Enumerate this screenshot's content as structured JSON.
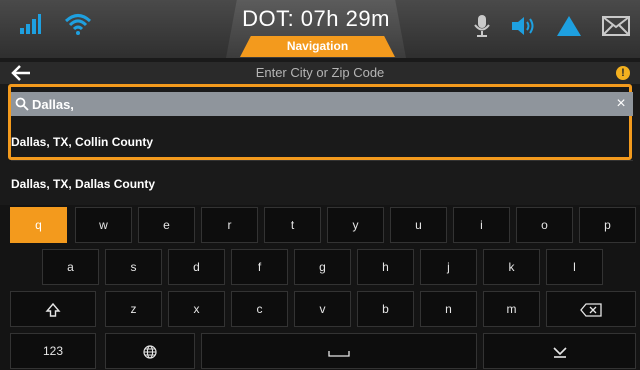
{
  "status": {
    "dot_label": "DOT: 07h 29m",
    "nav_tab": "Navigation"
  },
  "colors": {
    "accent": "#f39a1d",
    "wifi": "#1ea0e0",
    "signal": "#1ea0e0",
    "warning": "#1ea0e0"
  },
  "header": {
    "title": "Enter City or Zip Code",
    "info_badge": "!"
  },
  "search": {
    "value": "Dallas,",
    "clear": "×"
  },
  "results": [
    {
      "label": "Dallas, TX, Collin County"
    },
    {
      "label": "Dallas, TX, Dallas County"
    }
  ],
  "keyboard": {
    "row1": [
      "q",
      "w",
      "e",
      "r",
      "t",
      "y",
      "u",
      "i",
      "o",
      "p"
    ],
    "row2": [
      "a",
      "s",
      "d",
      "f",
      "g",
      "h",
      "j",
      "k",
      "l"
    ],
    "row3": [
      "z",
      "x",
      "c",
      "v",
      "b",
      "n",
      "m"
    ],
    "numbers_key": "123"
  }
}
